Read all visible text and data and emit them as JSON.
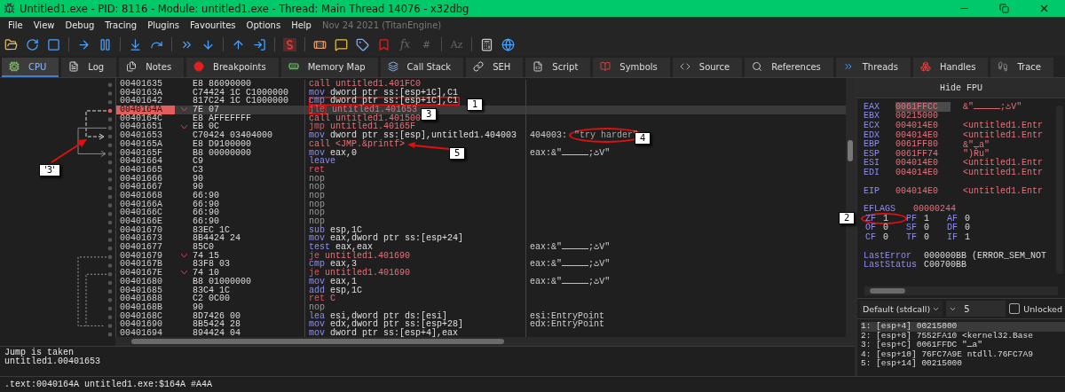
{
  "window": {
    "title": "Untitled1.exe - PID: 8116 - Module: untitled1.exe - Thread: Main Thread 14076 - x32dbg"
  },
  "menu": {
    "items": [
      "File",
      "View",
      "Debug",
      "Tracing",
      "Plugins",
      "Favourites",
      "Options",
      "Help"
    ],
    "build": "Nov 24 2021 (TitanEngine)"
  },
  "toolbar": {
    "glyphs": [
      "fx",
      "#",
      "Az"
    ]
  },
  "tabs": [
    {
      "label": "CPU",
      "selected": true
    },
    {
      "label": "Log",
      "selected": false
    },
    {
      "label": "Notes",
      "selected": false
    },
    {
      "label": "Breakpoints",
      "selected": false
    },
    {
      "label": "Memory Map",
      "selected": false
    },
    {
      "label": "Call Stack",
      "selected": false
    },
    {
      "label": "SEH",
      "selected": false
    },
    {
      "label": "Script",
      "selected": false
    },
    {
      "label": "Symbols",
      "selected": false
    },
    {
      "label": "Source",
      "selected": false
    },
    {
      "label": "References",
      "selected": false
    },
    {
      "label": "Threads",
      "selected": false
    },
    {
      "label": "Handles",
      "selected": false
    },
    {
      "label": "Trace",
      "selected": false
    }
  ],
  "disasm": {
    "rows": [
      {
        "address": "00401635",
        "bytes": "E8 86090000",
        "mnemonic": "call",
        "operands": "untitled1.401FC0",
        "kind": "call",
        "selected": false
      },
      {
        "address": "0040163A",
        "bytes": "C74424 1C C1000000",
        "mnemonic": "mov",
        "operands": "dword ptr ss:[esp+1C],C1",
        "kind": "op",
        "selected": false
      },
      {
        "address": "00401642",
        "bytes": "817C24 1C C1000000",
        "mnemonic": "cmp",
        "operands": "dword ptr ss:[esp+1C],C1",
        "kind": "op",
        "selected": false,
        "boxed": true
      },
      {
        "address": "0040164A",
        "bytes": "7E 07",
        "mnemonic": "jle",
        "operands": "untitled1.401653",
        "kind": "jump",
        "selected": true,
        "mnemonic_boxed": true
      },
      {
        "address": "0040164C",
        "bytes": "E8 AFFEFFFF",
        "mnemonic": "call",
        "operands": "untitled1.401500",
        "kind": "call",
        "selected": false
      },
      {
        "address": "00401651",
        "bytes": "EB 0C",
        "mnemonic": "jmp",
        "operands": "untitled1.40165F",
        "kind": "jump",
        "selected": false
      },
      {
        "address": "00401653",
        "bytes": "C70424 03404000",
        "mnemonic": "mov",
        "operands": "dword ptr ss:[esp],untitled1.404003",
        "kind": "op",
        "selected": false,
        "comment": "404003:",
        "string": "\"try harder\"",
        "circled": true
      },
      {
        "address": "0040165A",
        "bytes": "E8 D9100000",
        "mnemonic": "call",
        "operands": "<JMP.&printf>",
        "kind": "call",
        "selected": false
      },
      {
        "address": "0040165F",
        "bytes": "B8 00000000",
        "mnemonic": "mov",
        "operands": "eax,0",
        "kind": "op",
        "selected": false,
        "comment": "eax:&\"ٹ;ـــــV\""
      },
      {
        "address": "00401664",
        "bytes": "C9",
        "mnemonic": "leave",
        "operands": "",
        "kind": "op",
        "selected": false
      },
      {
        "address": "00401665",
        "bytes": "C3",
        "mnemonic": "ret",
        "operands": "",
        "kind": "ret",
        "selected": false
      },
      {
        "address": "00401666",
        "bytes": "90",
        "mnemonic": "nop",
        "operands": "",
        "kind": "nop",
        "selected": false
      },
      {
        "address": "00401667",
        "bytes": "90",
        "mnemonic": "nop",
        "operands": "",
        "kind": "nop",
        "selected": false
      },
      {
        "address": "00401668",
        "bytes": "66:90",
        "mnemonic": "nop",
        "operands": "",
        "kind": "nop",
        "selected": false
      },
      {
        "address": "0040166A",
        "bytes": "66:90",
        "mnemonic": "nop",
        "operands": "",
        "kind": "nop",
        "selected": false
      },
      {
        "address": "0040166C",
        "bytes": "66:90",
        "mnemonic": "nop",
        "operands": "",
        "kind": "nop",
        "selected": false
      },
      {
        "address": "0040166E",
        "bytes": "66:90",
        "mnemonic": "nop",
        "operands": "",
        "kind": "nop",
        "selected": false
      },
      {
        "address": "00401670",
        "bytes": "83EC 1C",
        "mnemonic": "sub",
        "operands": "esp,1C",
        "kind": "op",
        "selected": false
      },
      {
        "address": "00401673",
        "bytes": "8B4424 24",
        "mnemonic": "mov",
        "operands": "eax,dword ptr ss:[esp+24]",
        "kind": "op",
        "selected": false
      },
      {
        "address": "00401677",
        "bytes": "85C0",
        "mnemonic": "test",
        "operands": "eax,eax",
        "kind": "op",
        "selected": false,
        "comment": "eax:&\"ٹ;ـــــV\""
      },
      {
        "address": "00401679",
        "bytes": "74 15",
        "mnemonic": "je",
        "operands": "untitled1.401690",
        "kind": "jump",
        "selected": false
      },
      {
        "address": "0040167B",
        "bytes": "83F8 03",
        "mnemonic": "cmp",
        "operands": "eax,3",
        "kind": "op",
        "selected": false,
        "comment": "eax:&\"ٹ;ـــــV\""
      },
      {
        "address": "0040167E",
        "bytes": "74 10",
        "mnemonic": "je",
        "operands": "untitled1.401690",
        "kind": "jump",
        "selected": false
      },
      {
        "address": "00401680",
        "bytes": "B8 01000000",
        "mnemonic": "mov",
        "operands": "eax,1",
        "kind": "op",
        "selected": false,
        "comment": "eax:&\"ٹ;ـــــV\""
      },
      {
        "address": "00401685",
        "bytes": "83C4 1C",
        "mnemonic": "add",
        "operands": "esp,1C",
        "kind": "op",
        "selected": false
      },
      {
        "address": "00401688",
        "bytes": "C2 0C00",
        "mnemonic": "ret",
        "operands": "C",
        "kind": "ret",
        "selected": false
      },
      {
        "address": "0040168B",
        "bytes": "90",
        "mnemonic": "nop",
        "operands": "",
        "kind": "nop",
        "selected": false
      },
      {
        "address": "0040168C",
        "bytes": "8D7426 00",
        "mnemonic": "lea",
        "operands": "esi,dword ptr ds:[esi]",
        "kind": "op",
        "selected": false,
        "comment": "esi:EntryPoint"
      },
      {
        "address": "00401690",
        "bytes": "8B5424 28",
        "mnemonic": "mov",
        "operands": "edx,dword ptr ss:[esp+28]",
        "kind": "op",
        "selected": false,
        "comment": "edx:EntryPoint"
      },
      {
        "address": "00401694",
        "bytes": "894424 04",
        "mnemonic": "mov",
        "operands": "dword ptr ss:[esp+4],eax",
        "kind": "op",
        "selected": false
      }
    ]
  },
  "info": [
    "Jump is taken",
    "untitled1.00401653"
  ],
  "status": ".text:0040164A untitled1.exe:$164A #A4A",
  "registers_panel": {
    "header": "Hide FPU",
    "registers": [
      {
        "name": "EAX",
        "value": "0061FFCC",
        "comment": "&\"ٹ;ـــــV\"",
        "selected": true
      },
      {
        "name": "EBX",
        "value": "00215000",
        "selected": false
      },
      {
        "name": "ECX",
        "value": "004014E0",
        "comment": "<untitled1.Entr",
        "selected": false
      },
      {
        "name": "EDX",
        "value": "004014E0",
        "comment": "<untitled1.Entr",
        "selected": false
      },
      {
        "name": "EBP",
        "value": "0061FF80",
        "comment": "&\"ـa\"",
        "selected": false
      },
      {
        "name": "ESP",
        "value": "0061FF74",
        "comment": "\")Řu\"",
        "selected": false
      },
      {
        "name": "ESI",
        "value": "004014E0",
        "comment": "<untitled1.Entr",
        "selected": false
      },
      {
        "name": "EDI",
        "value": "004014E0",
        "comment": "<untitled1.Entr",
        "selected": false
      }
    ],
    "eip": {
      "name": "EIP",
      "value": "004014E0",
      "comment": "<untitled1.Entr"
    },
    "eflags": {
      "name": "EFLAGS",
      "value": "00000244"
    },
    "flags": [
      [
        {
          "name": "ZF",
          "value": "1",
          "circled": true
        },
        {
          "name": "PF",
          "value": "1"
        },
        {
          "name": "AF",
          "value": "0"
        }
      ],
      [
        {
          "name": "OF",
          "value": "0"
        },
        {
          "name": "SF",
          "value": "0"
        },
        {
          "name": "DF",
          "value": "0"
        }
      ],
      [
        {
          "name": "CF",
          "value": "0"
        },
        {
          "name": "TF",
          "value": "0"
        },
        {
          "name": "IF",
          "value": "1"
        }
      ]
    ],
    "last": [
      {
        "name": "LastError",
        "value": "000000BB (ERROR_SEM_NOT"
      },
      {
        "name": "LastStatus",
        "value": "C00700BB"
      }
    ]
  },
  "call_convention": {
    "value": "Default (stdcall)",
    "count": "5",
    "unlocked": {
      "label": "Unlocked",
      "checked": false
    }
  },
  "stack_args": [
    {
      "text": "1: [esp+4] 00215000",
      "selected": true
    },
    {
      "text": "2: [esp+8] 7552FA10 <kernel32.Base",
      "selected": false
    },
    {
      "text": "3: [esp+C] 0061FFDC \"ـa\"",
      "selected": false
    },
    {
      "text": "4: [esp+10] 76FC7A9E ntdll.76FC7A9",
      "selected": false
    },
    {
      "text": "5: [esp+14] 00215000",
      "selected": false
    }
  ],
  "annotations": [
    {
      "label": "1"
    },
    {
      "label": "2"
    },
    {
      "label": "3"
    },
    {
      "label": "4"
    },
    {
      "label": "5"
    },
    {
      "label": "'3'"
    }
  ]
}
